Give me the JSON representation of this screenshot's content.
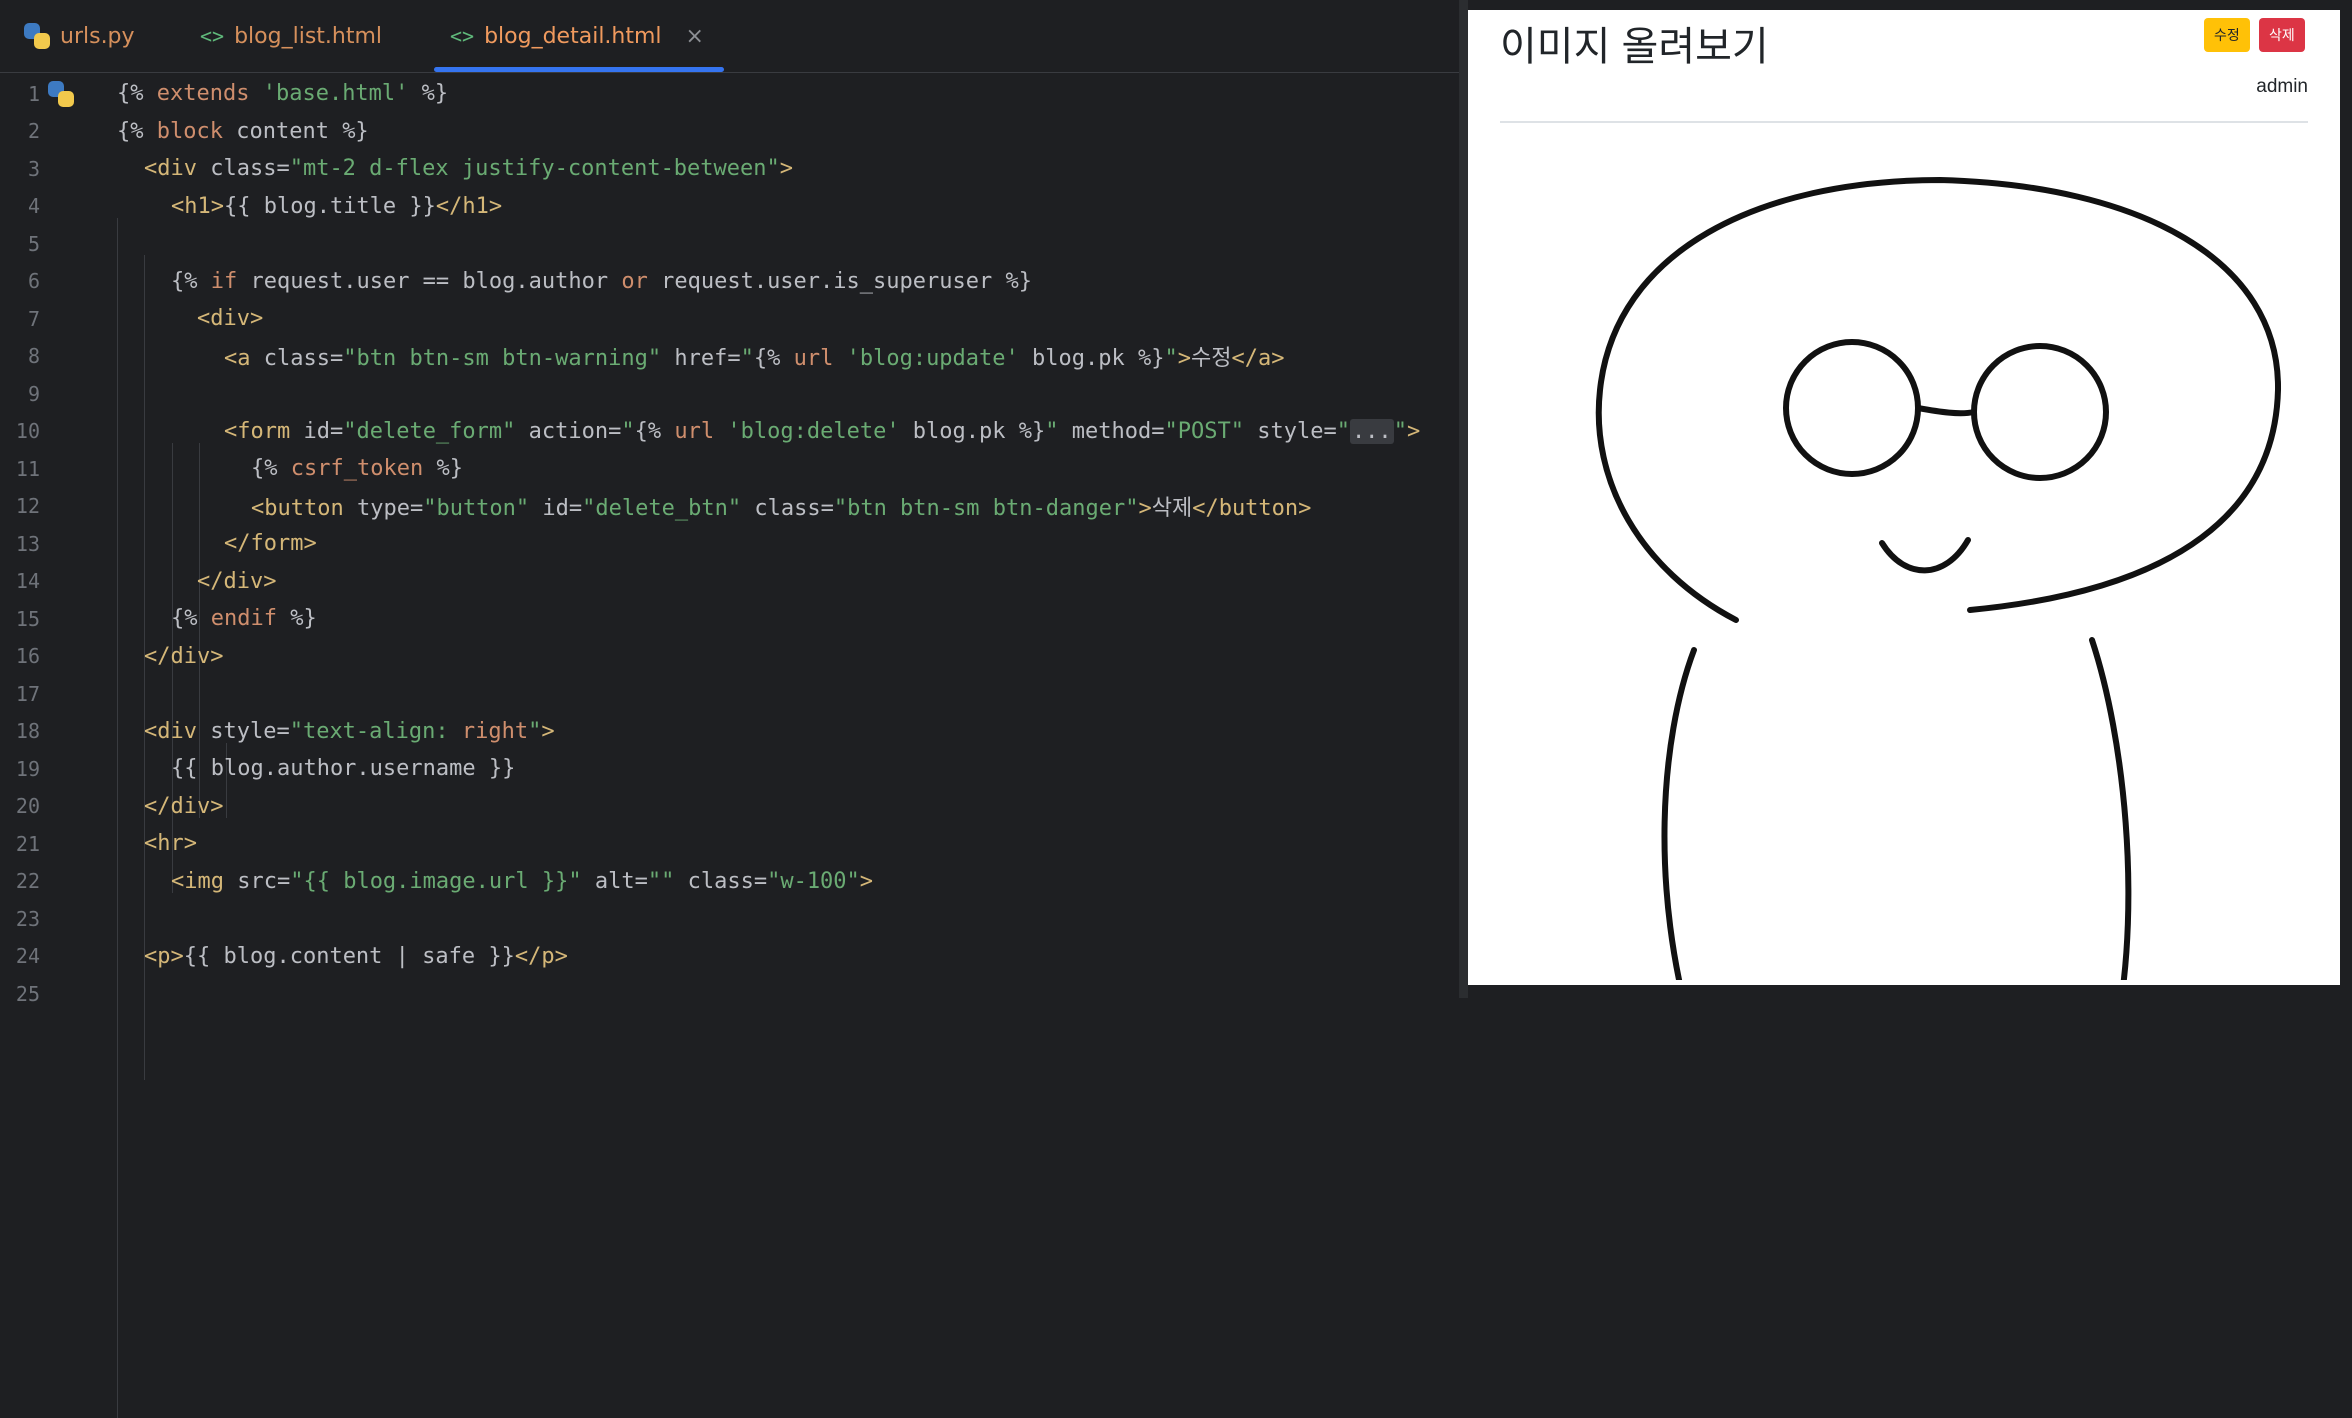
{
  "tabs": [
    {
      "label": "urls.py",
      "icon": "python-file-icon"
    },
    {
      "label": "blog_list.html",
      "icon": "html-file-icon"
    },
    {
      "label": "blog_detail.html",
      "icon": "html-file-icon",
      "active": true
    }
  ],
  "line_numbers": [
    "1",
    "2",
    "3",
    "4",
    "5",
    "6",
    "7",
    "8",
    "9",
    "10",
    "11",
    "12",
    "13",
    "14",
    "15",
    "16",
    "17",
    "18",
    "19",
    "20",
    "21",
    "22",
    "23",
    "24",
    "25"
  ],
  "code": {
    "l1": [
      "{% ",
      "extends",
      " ",
      "'base.html'",
      " %}"
    ],
    "l2": [
      "{% ",
      "block",
      " content %}"
    ],
    "l3": [
      "<div",
      " class=",
      "\"mt-2 d-flex justify-content-between\"",
      ">"
    ],
    "l4": [
      "<h1>",
      "{{ blog.title }}",
      "</h1>"
    ],
    "l6": [
      "{% ",
      "if",
      " request.user == blog.author ",
      "or",
      " request.user.is_superuser %}"
    ],
    "l7": [
      "<div>"
    ],
    "l8": [
      "<a",
      " class=",
      "\"btn btn-sm btn-warning\"",
      " href=",
      "\"",
      "{% ",
      "url",
      " ",
      "'blog:update'",
      " blog.pk %}",
      "\"",
      ">",
      "수정",
      "</a>"
    ],
    "l10": [
      "<form",
      " id=",
      "\"delete_form\"",
      " action=",
      "\"",
      "{% ",
      "url",
      " ",
      "'blog:delete'",
      " blog.pk %}",
      "\"",
      " method=",
      "\"POST\"",
      " style=",
      "\"",
      "...",
      "\"",
      ">"
    ],
    "l11": [
      "{% ",
      "csrf_token",
      " %}"
    ],
    "l12": [
      "<button",
      " type=",
      "\"button\"",
      " id=",
      "\"delete_btn\"",
      " class=",
      "\"btn btn-sm btn-danger\"",
      ">",
      "삭제",
      "</button>"
    ],
    "l13": [
      "</form>"
    ],
    "l14": [
      "</div>"
    ],
    "l15": [
      "{% ",
      "endif",
      " %}"
    ],
    "l16": [
      "</div>"
    ],
    "l18": [
      "<div",
      " style=",
      "\"text-align: ",
      "right",
      "\"",
      ">"
    ],
    "l19": [
      "{{ blog.author.username }}"
    ],
    "l20": [
      "</div>"
    ],
    "l21": [
      "<hr>"
    ],
    "l22": [
      "<img",
      " src=",
      "\"{{ blog.image.url }}\"",
      " alt=",
      "\"\"",
      " class=",
      "\"w-100\"",
      ">"
    ],
    "l24": [
      "<p>",
      "{{ blog.content | safe }}",
      "</p>"
    ]
  },
  "preview": {
    "title": "이미지 올려보기",
    "edit_button": "수정",
    "delete_button": "삭제",
    "author": "admin"
  },
  "colors": {
    "keyword": "#cf8e6d",
    "tag": "#d5b778",
    "string": "#6aab73",
    "text": "#bcbec4",
    "active_tab_underline": "#3574f0",
    "highlight_box": "#c22a2a"
  }
}
